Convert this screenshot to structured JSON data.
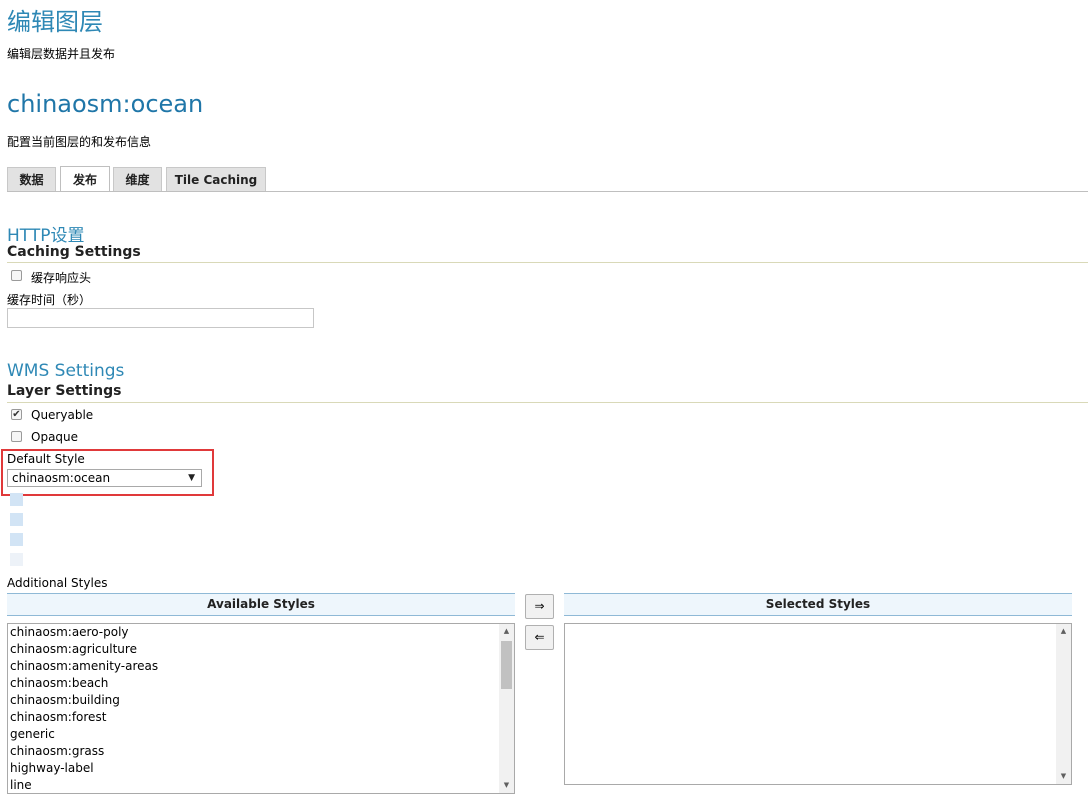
{
  "header": {
    "title": "编辑图层",
    "subtitle": "编辑层数据并且发布"
  },
  "layer": {
    "name": "chinaosm:ocean",
    "description": "配置当前图层的和发布信息"
  },
  "tabs": [
    {
      "label": "数据",
      "active": false
    },
    {
      "label": "发布",
      "active": true
    },
    {
      "label": "维度",
      "active": false
    },
    {
      "label": "Tile Caching",
      "active": false
    }
  ],
  "http": {
    "section_title": "HTTP设置",
    "sub_title": "Caching Settings",
    "cache_headers_label": "缓存响应头",
    "cache_headers_checked": false,
    "cache_time_label": "缓存时间（秒）",
    "cache_time_value": ""
  },
  "wms": {
    "section_title": "WMS Settings",
    "sub_title": "Layer Settings",
    "queryable_label": "Queryable",
    "queryable_checked": true,
    "opaque_label": "Opaque",
    "opaque_checked": false,
    "default_style_label": "Default Style",
    "default_style_value": "chinaosm:ocean",
    "additional_styles_label": "Additional Styles",
    "available_header": "Available Styles",
    "selected_header": "Selected Styles",
    "move_right_symbol": "⇒",
    "move_left_symbol": "⇐",
    "available_styles": [
      "chinaosm:aero-poly",
      "chinaosm:agriculture",
      "chinaosm:amenity-areas",
      "chinaosm:beach",
      "chinaosm:building",
      "chinaosm:forest",
      "generic",
      "chinaosm:grass",
      "highway-label",
      "line"
    ],
    "selected_styles": []
  },
  "icons": {
    "check": "✔",
    "dropdown_arrow": "▼",
    "scroll_up": "▲",
    "scroll_down": "▼"
  },
  "colors": {
    "heading_blue": "#2e88b5",
    "highlight_red": "#e0393a"
  }
}
